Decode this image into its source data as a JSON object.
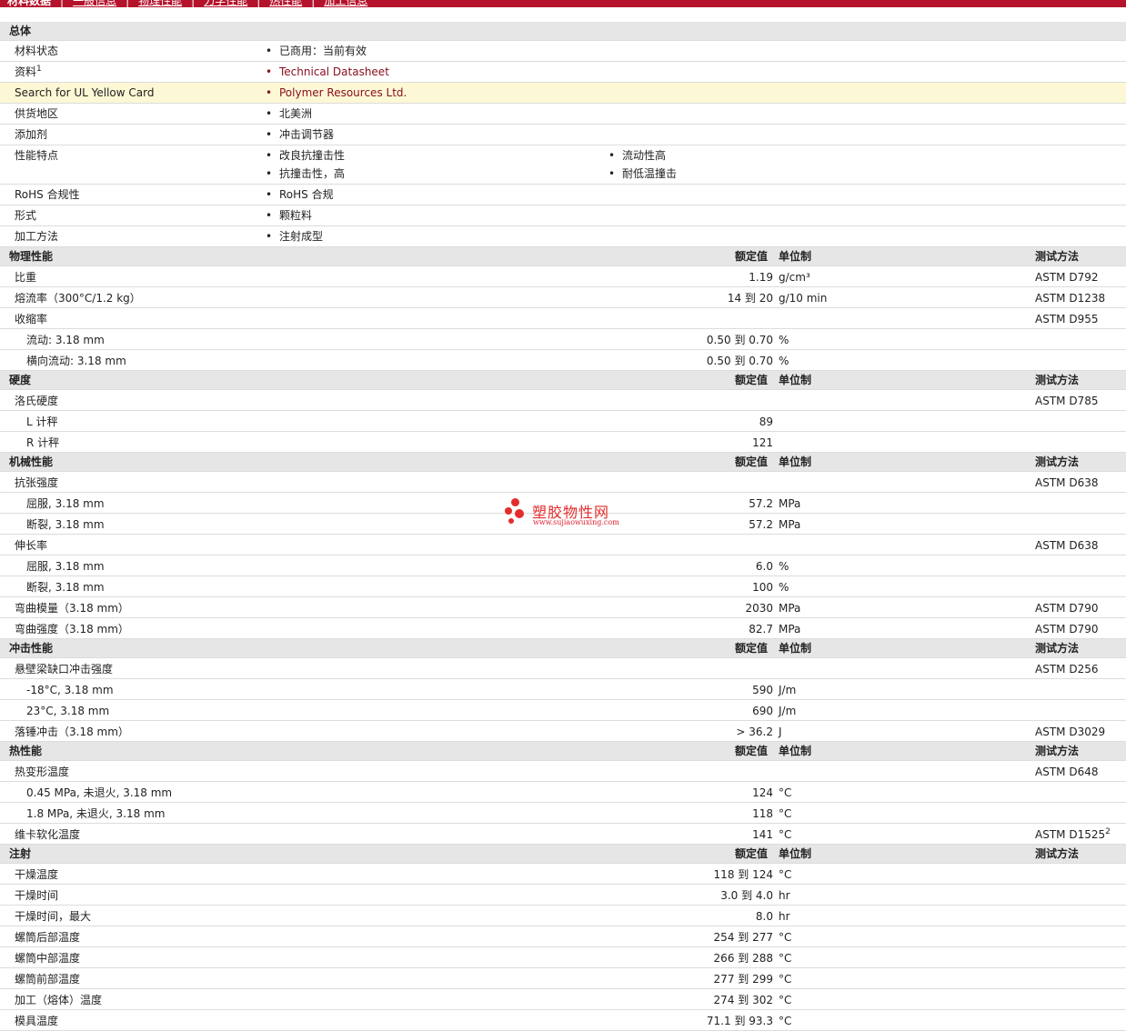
{
  "nav": {
    "tabs": [
      "材料数据",
      "一般信息",
      "物理性能",
      "力学性能",
      "热性能",
      "加工信息"
    ]
  },
  "header_labels": {
    "value": "额定值",
    "unit": "单位制",
    "method": "测试方法"
  },
  "general": {
    "title": "总体",
    "rows": [
      {
        "label": "材料状态",
        "items": [
          "已商用：当前有效"
        ]
      },
      {
        "label": "资料",
        "sup": "1",
        "items": [
          "Technical Datasheet"
        ],
        "link": true
      },
      {
        "label": "Search for UL Yellow Card",
        "items": [
          "Polymer Resources Ltd."
        ],
        "link": true,
        "highlight": true
      },
      {
        "label": "供货地区",
        "items": [
          "北美洲"
        ]
      },
      {
        "label": "添加剂",
        "items": [
          "冲击调节器"
        ]
      },
      {
        "label": "性能特点",
        "items": [
          "改良抗撞击性",
          "流动性高",
          "抗撞击性，高",
          "耐低温撞击"
        ]
      },
      {
        "label": "RoHS 合规性",
        "items": [
          "RoHS 合规"
        ]
      },
      {
        "label": "形式",
        "items": [
          "颗粒料"
        ]
      },
      {
        "label": "加工方法",
        "items": [
          "注射成型"
        ]
      }
    ]
  },
  "physical": {
    "title": "物理性能",
    "rows": [
      {
        "label": "比重",
        "value": "1.19",
        "unit": "g/cm³",
        "method": "ASTM D792"
      },
      {
        "label": "熔流率（300°C/1.2 kg）",
        "value": "14 到 20",
        "unit": "g/10 min",
        "method": "ASTM D1238"
      },
      {
        "label": "收缩率",
        "value": "",
        "unit": "",
        "method": "ASTM D955"
      },
      {
        "label": "流动: 3.18 mm",
        "value": "0.50 到 0.70",
        "unit": "%",
        "method": "",
        "sub": true
      },
      {
        "label": "横向流动: 3.18 mm",
        "value": "0.50 到 0.70",
        "unit": "%",
        "method": "",
        "sub": true
      }
    ]
  },
  "hardness": {
    "title": "硬度",
    "rows": [
      {
        "label": "洛氏硬度",
        "value": "",
        "unit": "",
        "method": "ASTM D785"
      },
      {
        "label": "L 计秤",
        "value": "89",
        "unit": "",
        "method": "",
        "sub": true
      },
      {
        "label": "R 计秤",
        "value": "121",
        "unit": "",
        "method": "",
        "sub": true
      }
    ]
  },
  "mechanical": {
    "title": "机械性能",
    "rows": [
      {
        "label": "抗张强度",
        "value": "",
        "unit": "",
        "method": "ASTM D638"
      },
      {
        "label": "屈服, 3.18 mm",
        "value": "57.2",
        "unit": "MPa",
        "method": "",
        "sub": true
      },
      {
        "label": "断裂, 3.18 mm",
        "value": "57.2",
        "unit": "MPa",
        "method": "",
        "sub": true
      },
      {
        "label": "伸长率",
        "value": "",
        "unit": "",
        "method": "ASTM D638"
      },
      {
        "label": "屈服, 3.18 mm",
        "value": "6.0",
        "unit": "%",
        "method": "",
        "sub": true
      },
      {
        "label": "断裂, 3.18 mm",
        "value": "100",
        "unit": "%",
        "method": "",
        "sub": true
      },
      {
        "label": "弯曲模量（3.18 mm）",
        "value": "2030",
        "unit": "MPa",
        "method": "ASTM D790"
      },
      {
        "label": "弯曲强度（3.18 mm）",
        "value": "82.7",
        "unit": "MPa",
        "method": "ASTM D790"
      }
    ]
  },
  "impact": {
    "title": "冲击性能",
    "rows": [
      {
        "label": "悬壁梁缺口冲击强度",
        "value": "",
        "unit": "",
        "method": "ASTM D256"
      },
      {
        "label": "-18°C, 3.18 mm",
        "value": "590",
        "unit": "J/m",
        "method": "",
        "sub": true
      },
      {
        "label": "23°C, 3.18 mm",
        "value": "690",
        "unit": "J/m",
        "method": "",
        "sub": true
      },
      {
        "label": "落锤冲击（3.18 mm）",
        "value": "> 36.2",
        "unit": "J",
        "method": "ASTM D3029"
      }
    ]
  },
  "thermal": {
    "title": "热性能",
    "rows": [
      {
        "label": "热变形温度",
        "value": "",
        "unit": "",
        "method": "ASTM D648"
      },
      {
        "label": "0.45 MPa, 未退火, 3.18 mm",
        "value": "124",
        "unit": "°C",
        "method": "",
        "sub": true
      },
      {
        "label": "1.8 MPa, 未退火, 3.18 mm",
        "value": "118",
        "unit": "°C",
        "method": "",
        "sub": true
      },
      {
        "label": "维卡软化温度",
        "value": "141",
        "unit": "°C",
        "method": "ASTM D1525",
        "method_sup": "2"
      }
    ]
  },
  "injection": {
    "title": "注射",
    "rows": [
      {
        "label": "干燥温度",
        "value": "118 到 124",
        "unit": "°C",
        "method": ""
      },
      {
        "label": "干燥时间",
        "value": "3.0 到 4.0",
        "unit": "hr",
        "method": ""
      },
      {
        "label": "干燥时间，最大",
        "value": "8.0",
        "unit": "hr",
        "method": ""
      },
      {
        "label": "螺筒后部温度",
        "value": "254 到 277",
        "unit": "°C",
        "method": ""
      },
      {
        "label": "螺筒中部温度",
        "value": "266 到 288",
        "unit": "°C",
        "method": ""
      },
      {
        "label": "螺筒前部温度",
        "value": "277 到 299",
        "unit": "°C",
        "method": ""
      },
      {
        "label": "加工（熔体）温度",
        "value": "274 到 302",
        "unit": "°C",
        "method": ""
      },
      {
        "label": "模具温度",
        "value": "71.1 到 93.3",
        "unit": "°C",
        "method": ""
      }
    ]
  },
  "watermark": {
    "brand": "塑胶物性网",
    "url": "www.sujiaowuxing.com"
  },
  "colors": {
    "brand_red": "#b5122b",
    "link": "#8a1020",
    "section_bg": "#e6e6e6",
    "highlight_bg": "#fcf8d5"
  }
}
